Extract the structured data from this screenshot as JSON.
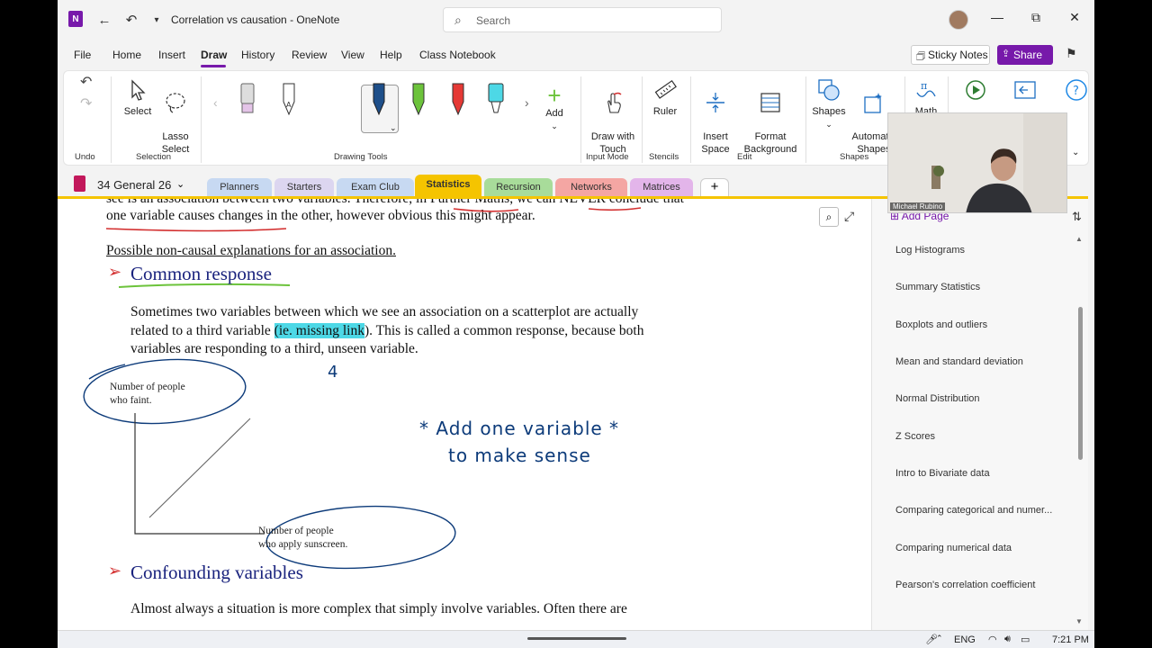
{
  "window": {
    "title": "Correlation vs causation  -  OneNote",
    "search_placeholder": "Search"
  },
  "menu": {
    "items": [
      "File",
      "Home",
      "Insert",
      "Draw",
      "History",
      "Review",
      "View",
      "Help",
      "Class Notebook"
    ],
    "active": "Draw",
    "sticky_notes": "Sticky Notes",
    "share": "Share"
  },
  "ribbon": {
    "undo_group": "Undo",
    "select": "Select",
    "lasso_select": "Lasso\nSelect",
    "selection_group": "Selection",
    "drawing_tools_group": "Drawing Tools",
    "add": "Add",
    "draw_with_touch": "Draw with\nTouch",
    "input_mode_group": "Input Mode",
    "ruler": "Ruler",
    "stencils_group": "Stencils",
    "insert_space": "Insert\nSpace",
    "format_background": "Format\nBackground",
    "edit_group": "Edit",
    "shapes": "Shapes",
    "automatic_shapes": "Automatic\nShapes",
    "shapes_group": "Shapes",
    "math": "Math",
    "pen_colors": [
      "#e4c4e8",
      "#ffffff",
      "#1e4f8a",
      "#6cc33b",
      "#e53935",
      "#4dd8e6"
    ]
  },
  "notebook": {
    "name": "34 General 26",
    "tabs": [
      {
        "label": "Planners",
        "color": "#c7d9f2"
      },
      {
        "label": "Starters",
        "color": "#dcd6f0"
      },
      {
        "label": "Exam Club",
        "color": "#c7d9f2"
      },
      {
        "label": "Statistics",
        "color": "#f5c400",
        "active": true
      },
      {
        "label": "Recursion",
        "color": "#a8dc9a"
      },
      {
        "label": "Networks",
        "color": "#f4a6a3"
      },
      {
        "label": "Matrices",
        "color": "#e3b5ea"
      }
    ]
  },
  "page": {
    "line_top_cut": "see is an association between two variables. Therefore, in Further Maths, we can NEVER conclude that",
    "line_causes": "one variable causes changes in the other, however obvious this might appear.",
    "subtitle": "Possible non-causal explanations for an association.",
    "heading_common": "Common response",
    "para1_line1": "Sometimes two variables between which we see an association on a scatterplot are actually",
    "para1_line2_pre": "related to a third variable ",
    "para1_highlight": "(ie. missing link",
    "para1_line2_post": "). This is called a common response, because both",
    "para1_line3": "variables are responding to a third, unseen variable.",
    "handwriting_mark": "4",
    "graph_y_label_1": "Number of people",
    "graph_y_label_2": "who faint.",
    "graph_x_label_1": "Number of people",
    "graph_x_label_2": "who apply sunscreen.",
    "handwritten_note_1": "* Add  one  variable  *",
    "handwritten_note_2": "to  make  sense",
    "heading_confounding": "Confounding variables",
    "para2_line1_cut": "Almost always a situation is more complex that simply involve variables. Often there are"
  },
  "pages_panel": {
    "add_page": "Add Page",
    "items": [
      "Log Histograms",
      "Summary Statistics",
      "Boxplots and outliers",
      "Mean and standard deviation",
      "Normal Distribution",
      "Z Scores",
      "Intro to Bivariate data",
      "Comparing categorical and numer...",
      "Comparing numerical data",
      "Pearson's correlation coefficient"
    ]
  },
  "webcam": {
    "name": "Michael Rubino"
  },
  "taskbar": {
    "language": "ENG",
    "time": "7:21 PM"
  }
}
